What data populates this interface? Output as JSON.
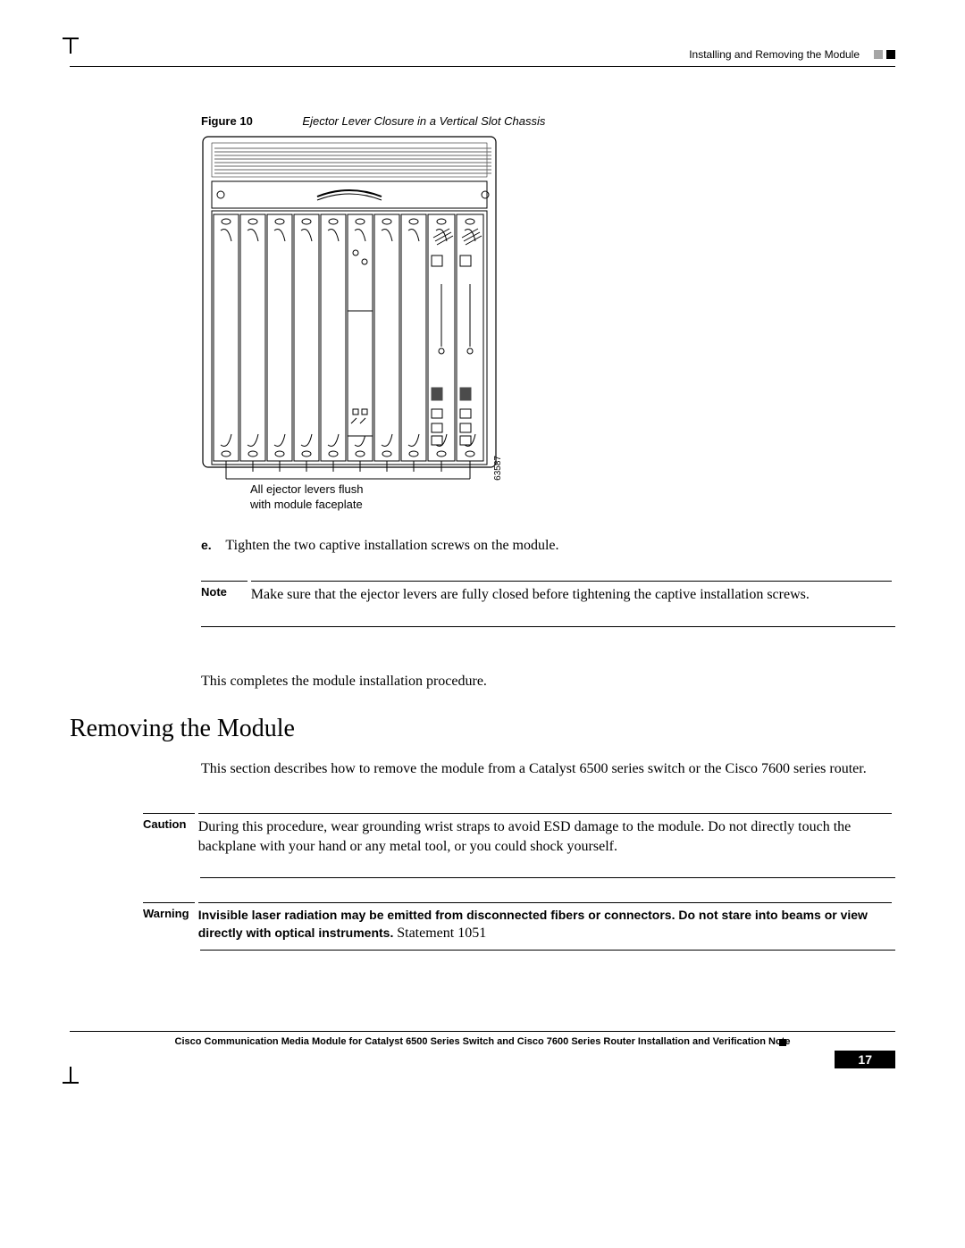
{
  "header": {
    "running_head": "Installing and Removing the Module"
  },
  "figure": {
    "label": "Figure 10",
    "title": "Ejector Lever Closure in a Vertical Slot Chassis",
    "sub_line1": "All ejector levers flush",
    "sub_line2": "with module faceplate",
    "part_number": "63587"
  },
  "step_e": {
    "letter": "e.",
    "text": "Tighten the two captive installation screws on the module."
  },
  "note": {
    "label": "Note",
    "text": "Make sure that the ejector levers are fully closed before tightening the captive installation screws."
  },
  "complete": "This completes the module installation procedure.",
  "section": {
    "heading": "Removing the Module",
    "intro": "This section describes how to remove the module from a Catalyst 6500 series switch or the Cisco 7600 series router."
  },
  "caution": {
    "label": "Caution",
    "text": "During this procedure, wear grounding wrist straps to avoid ESD damage to the module. Do not directly touch the backplane with your hand or any metal tool, or you could shock yourself."
  },
  "warning": {
    "label": "Warning",
    "text_bold": "Invisible laser radiation may be emitted from disconnected fibers or connectors. Do not stare into beams or view directly with optical instruments.",
    "statement": " Statement 1051"
  },
  "footer": {
    "doc_title": "Cisco Communication Media Module for Catalyst 6500 Series Switch and Cisco 7600 Series Router Installation and Verification Note",
    "page": "17"
  }
}
